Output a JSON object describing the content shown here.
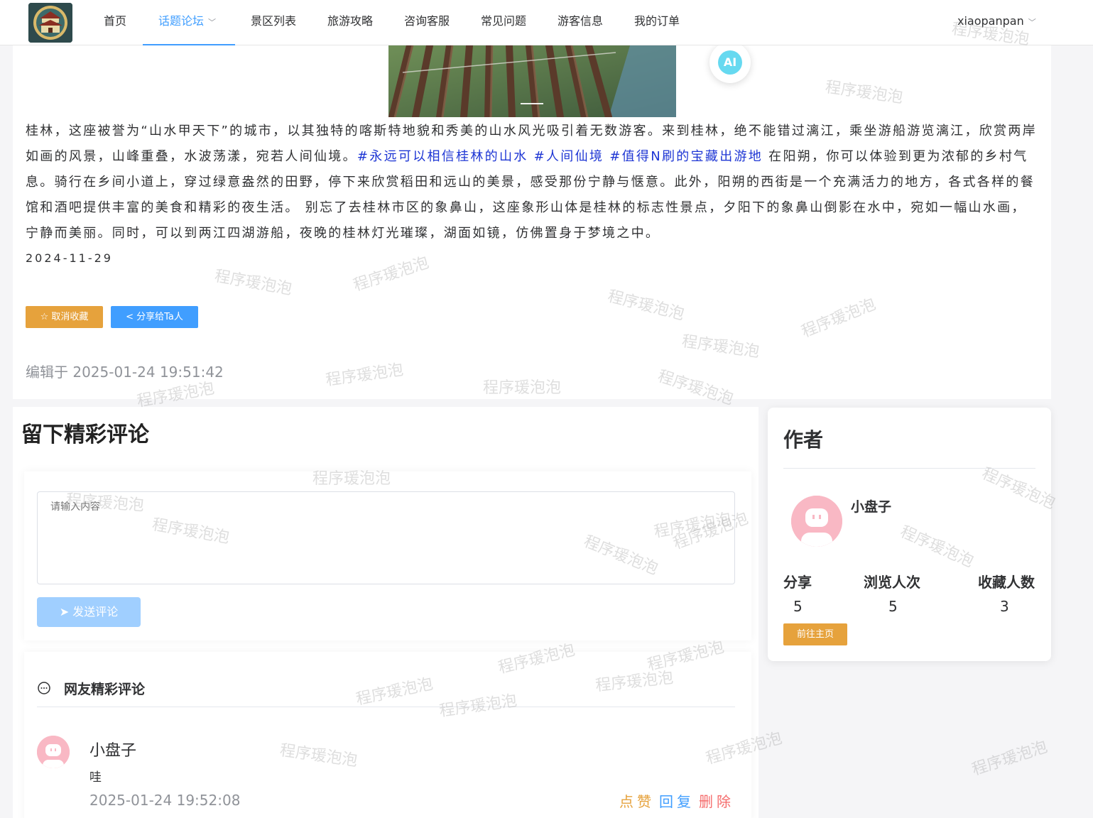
{
  "nav": {
    "items": [
      {
        "label": "首页"
      },
      {
        "label": "话题论坛"
      },
      {
        "label": "景区列表"
      },
      {
        "label": "旅游攻略"
      },
      {
        "label": "咨询客服"
      },
      {
        "label": "常见问题"
      },
      {
        "label": "游客信息"
      },
      {
        "label": "我的订单"
      }
    ],
    "user": "xiaopanpan"
  },
  "ai_label": "AI",
  "post": {
    "text_1": "桂林，这座被誉为“山水甲天下”的城市，以其独特的喀斯特地貌和秀美的山水风光吸引着无数游客。来到桂林，绝不能错过漓江，乘坐游船游览漓江，欣赏两岸如画的风景，山峰重叠，水波荡漾，宛若人间仙境。",
    "tags": [
      "#永远可以相信桂林的山水",
      "#人间仙境",
      "#值得N刷的宝藏出游地"
    ],
    "text_2": "在阳朔，你可以体验到更为浓郁的乡村气息。骑行在乡间小道上，穿过绿意盎然的田野，停下来欣赏稻田和远山的美景，感受那份宁静与惬意。此外，阳朔的西街是一个充满活力的地方，各式各样的餐馆和酒吧提供丰富的美食和精彩的夜生活。 别忘了去桂林市区的象鼻山，这座象形山体是桂林的标志性景点，夕阳下的象鼻山倒影在水中，宛如一幅山水画，宁静而美丽。同时，可以到两江四湖游船，夜晚的桂林灯光璀璨，湖面如镜，仿佛置身于梦境之中。",
    "date": "2024-11-29",
    "fav_label": "取消收藏",
    "share_label": "分享给Ta人",
    "edited": "编辑于 2025-01-24 19:51:42"
  },
  "comments": {
    "title": "留下精彩评论",
    "placeholder": "请输入内容",
    "send_label": "发送评论",
    "list_title": "网友精彩评论",
    "items": [
      {
        "name": "小盘子",
        "content": "哇",
        "time": "2025-01-24 19:52:08",
        "like": "点赞",
        "reply": "回复",
        "delete": "删除"
      }
    ]
  },
  "author": {
    "title": "作者",
    "name": "小盘子",
    "stats": [
      {
        "label": "分享",
        "value": "5"
      },
      {
        "label": "浏览人次",
        "value": "5"
      },
      {
        "label": "收藏人数",
        "value": "3"
      }
    ],
    "home_label": "前往主页"
  },
  "watermark": "程序瑗泡泡",
  "colors": {
    "primary": "#409eff",
    "warning": "#e6a23c",
    "danger": "#f56c6c",
    "tag": "#1e36d4"
  }
}
